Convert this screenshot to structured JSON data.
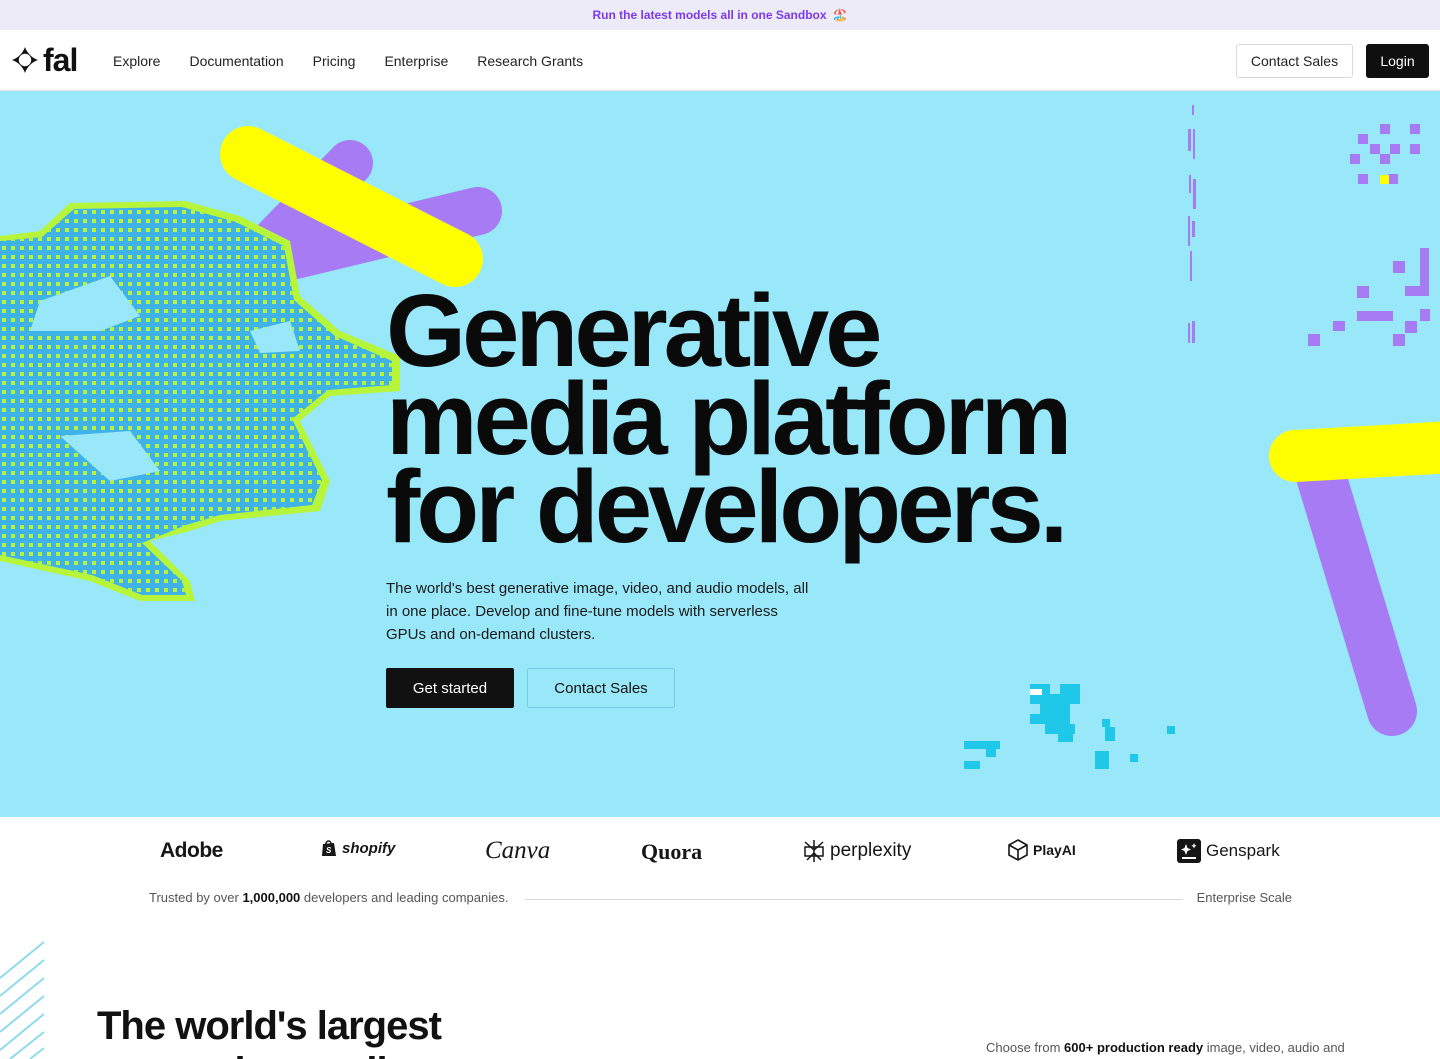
{
  "banner": {
    "text": "Run the latest models all in one Sandbox",
    "emoji": "🏖️"
  },
  "nav": {
    "logo_text": "fal",
    "links": [
      "Explore",
      "Documentation",
      "Pricing",
      "Enterprise",
      "Research Grants"
    ],
    "contact_label": "Contact Sales",
    "login_label": "Login"
  },
  "hero": {
    "title_lines": [
      "Generative",
      "media platform",
      "for developers."
    ],
    "subtitle": "The world's best generative image, video, and audio models, all in one place. Develop and fine-tune models with serverless GPUs and on-demand clusters.",
    "primary_cta": "Get started",
    "secondary_cta": "Contact Sales",
    "colors": {
      "background": "#98e8f9",
      "yellow": "#ffff00",
      "purple": "#a77bf3",
      "lime": "#b7f53a",
      "blue": "#3aa8e6"
    }
  },
  "brands": [
    "Adobe",
    "shopify",
    "Canva",
    "Quora",
    "perplexity",
    "PlayAI",
    "Genspark"
  ],
  "trust": {
    "prefix": "Trusted by over ",
    "count": "1,000,000",
    "suffix": " developers and leading companies.",
    "right": "Enterprise Scale"
  },
  "section2": {
    "title_lines": [
      "The world's largest",
      "generative media"
    ],
    "desc_prefix": "Choose from ",
    "desc_bold": "600+ production ready",
    "desc_suffix": " image, video, audio and"
  }
}
